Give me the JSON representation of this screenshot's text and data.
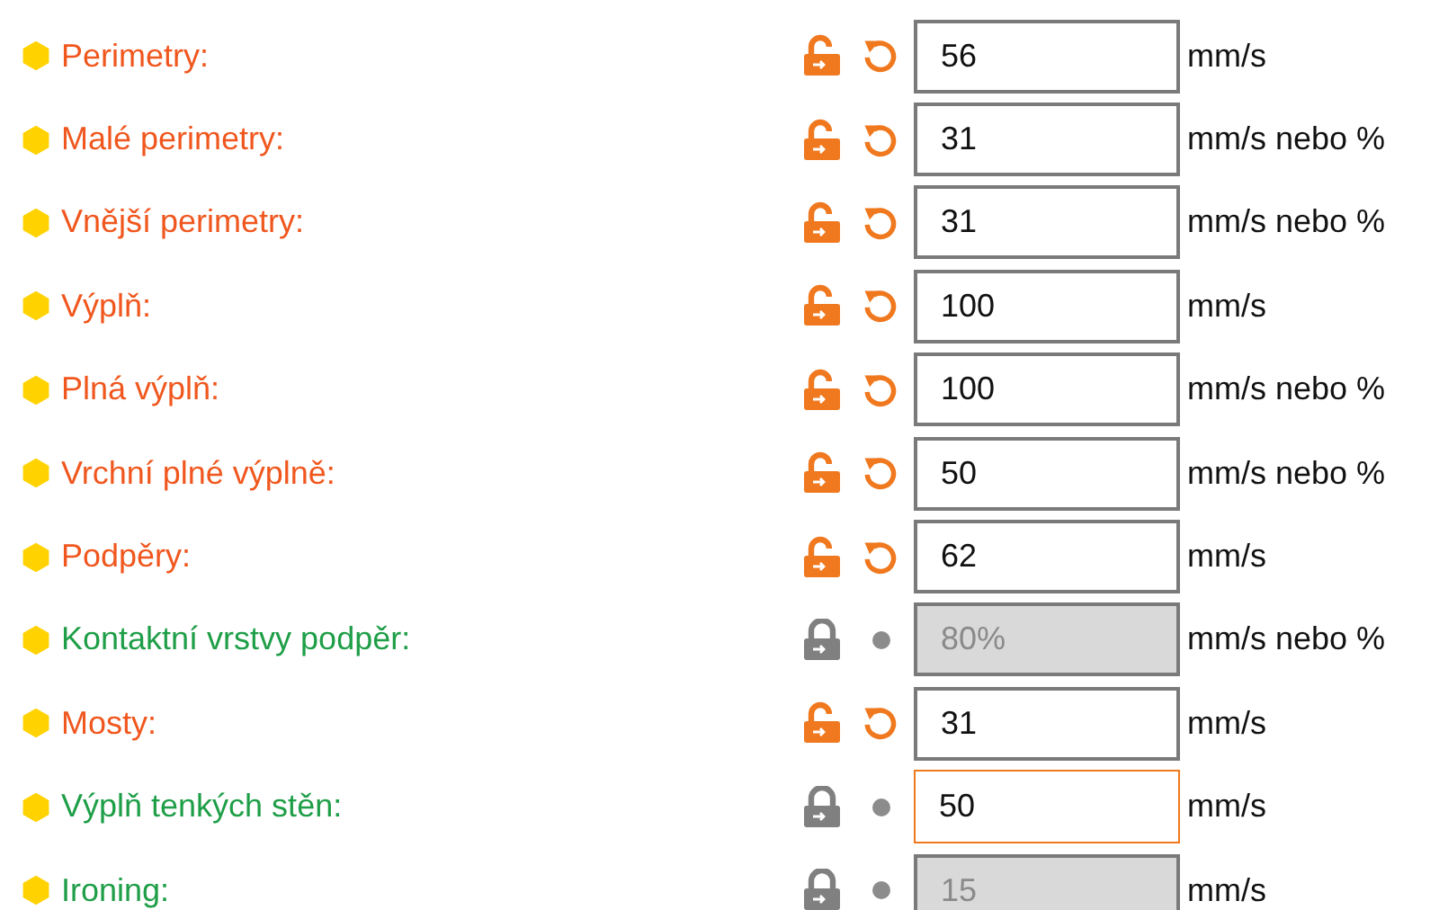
{
  "settings": [
    {
      "label": "Perimetry:",
      "modified": true,
      "value": "56",
      "unit": "mm/s",
      "disabled": false,
      "focused": false
    },
    {
      "label": "Malé perimetry:",
      "modified": true,
      "value": "31",
      "unit": "mm/s nebo %",
      "disabled": false,
      "focused": false
    },
    {
      "label": "Vnější perimetry:",
      "modified": true,
      "value": "31",
      "unit": "mm/s nebo %",
      "disabled": false,
      "focused": false
    },
    {
      "label": "Výplň:",
      "modified": true,
      "value": "100",
      "unit": "mm/s",
      "disabled": false,
      "focused": false
    },
    {
      "label": "Plná výplň:",
      "modified": true,
      "value": "100",
      "unit": "mm/s nebo %",
      "disabled": false,
      "focused": false
    },
    {
      "label": "Vrchní plné výplně:",
      "modified": true,
      "value": "50",
      "unit": "mm/s nebo %",
      "disabled": false,
      "focused": false
    },
    {
      "label": "Podpěry:",
      "modified": true,
      "value": "62",
      "unit": "mm/s",
      "disabled": false,
      "focused": false
    },
    {
      "label": "Kontaktní vrstvy podpěr:",
      "modified": false,
      "value": "80%",
      "unit": "mm/s nebo %",
      "disabled": true,
      "focused": false
    },
    {
      "label": "Mosty:",
      "modified": true,
      "value": "31",
      "unit": "mm/s",
      "disabled": false,
      "focused": false
    },
    {
      "label": "Výplň tenkých stěn:",
      "modified": false,
      "value": "50",
      "unit": "mm/s",
      "disabled": false,
      "focused": true
    },
    {
      "label": "Ironing:",
      "modified": false,
      "value": "15",
      "unit": "mm/s",
      "disabled": true,
      "focused": false
    }
  ]
}
